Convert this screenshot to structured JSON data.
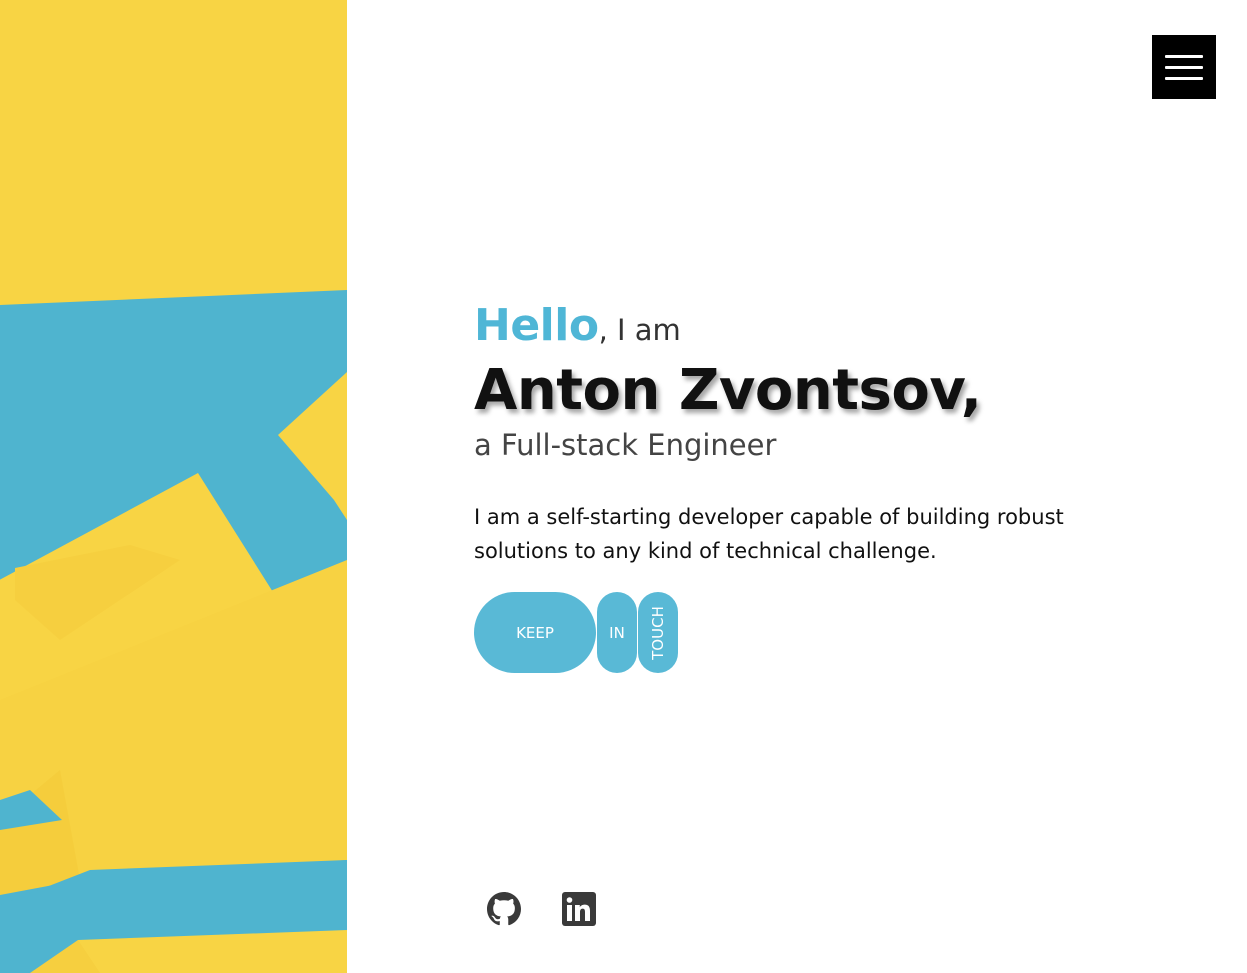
{
  "header": {
    "menu_icon": "hamburger-menu-icon"
  },
  "art": {
    "colors": {
      "yellow": "#f8d444",
      "blue": "#4fb4cf"
    }
  },
  "hero": {
    "hello": "Hello",
    "greeting_suffix": ", I am",
    "name": "Anton Zvontsov,",
    "role": "a Full-stack Engineer",
    "description": "I am a self-starting developer capable of building robust solutions to any kind of technical challenge."
  },
  "cta": {
    "word_1": "KEEP",
    "word_2": "IN",
    "word_3": "TOUCH",
    "color": "#59b9d6"
  },
  "social": {
    "github_icon": "github-icon",
    "linkedin_icon": "linkedin-icon"
  },
  "colors": {
    "accent": "#4fb6d6",
    "text": "#111111"
  }
}
